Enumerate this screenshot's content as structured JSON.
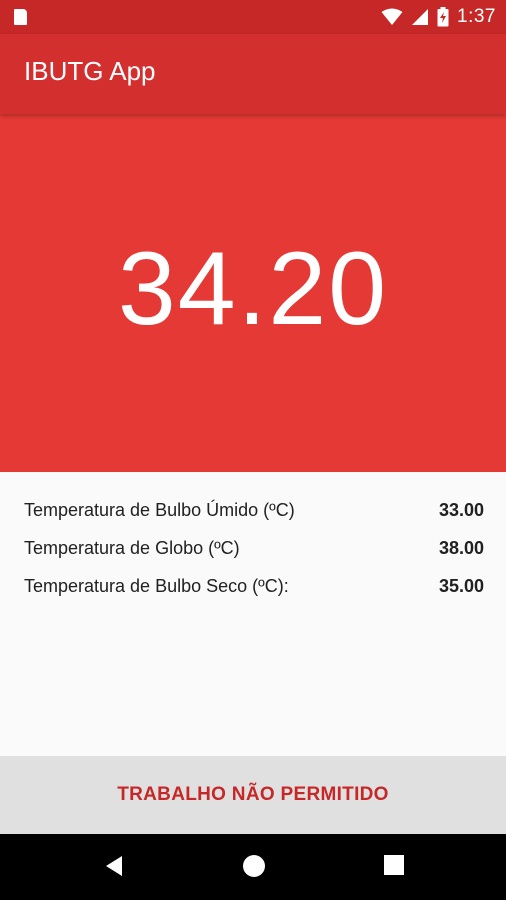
{
  "status_bar": {
    "time": "1:37",
    "icons": [
      "sd-card-icon",
      "wifi-icon",
      "cell-signal-icon",
      "battery-charging-icon"
    ]
  },
  "app_bar": {
    "title": "IBUTG App"
  },
  "ibutg": {
    "value": "34.20"
  },
  "readings": [
    {
      "label": "Temperatura de Bulbo Úmido (ºC)",
      "value": "33.00"
    },
    {
      "label": "Temperatura de Globo (ºC)",
      "value": "38.00"
    },
    {
      "label": "Temperatura de Bulbo Seco (ºC):",
      "value": "35.00"
    }
  ],
  "result": {
    "text": "TRABALHO NÃO PERMITIDO"
  },
  "nav_bar": {
    "buttons": [
      "back-icon",
      "home-icon",
      "recents-icon"
    ]
  },
  "colors": {
    "status_bar": "#c62828",
    "app_bar": "#d32f2f",
    "hero": "#e53935",
    "result_text": "#c62828",
    "result_bar": "#e0e0e0"
  }
}
